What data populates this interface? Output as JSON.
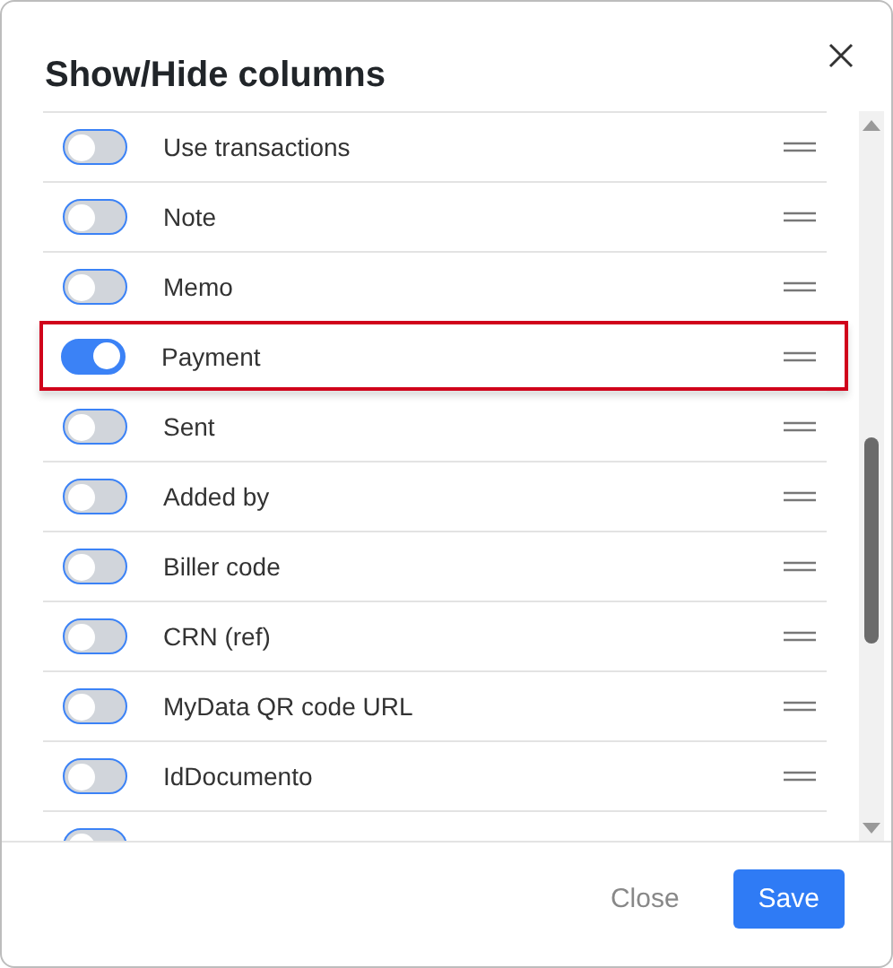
{
  "dialog": {
    "title": "Show/Hide columns"
  },
  "columns": [
    {
      "label": "Use transactions",
      "checked": false,
      "highlighted": false
    },
    {
      "label": "Note",
      "checked": false,
      "highlighted": false
    },
    {
      "label": "Memo",
      "checked": false,
      "highlighted": false
    },
    {
      "label": "Payment",
      "checked": true,
      "highlighted": true
    },
    {
      "label": "Sent",
      "checked": false,
      "highlighted": false
    },
    {
      "label": "Added by",
      "checked": false,
      "highlighted": false
    },
    {
      "label": "Biller code",
      "checked": false,
      "highlighted": false
    },
    {
      "label": "CRN (ref)",
      "checked": false,
      "highlighted": false
    },
    {
      "label": "MyData QR code URL",
      "checked": false,
      "highlighted": false
    },
    {
      "label": "IdDocumento",
      "checked": false,
      "highlighted": false
    },
    {
      "checked": false,
      "highlighted": false
    }
  ],
  "buttons": {
    "close": "Close",
    "save": "Save"
  }
}
